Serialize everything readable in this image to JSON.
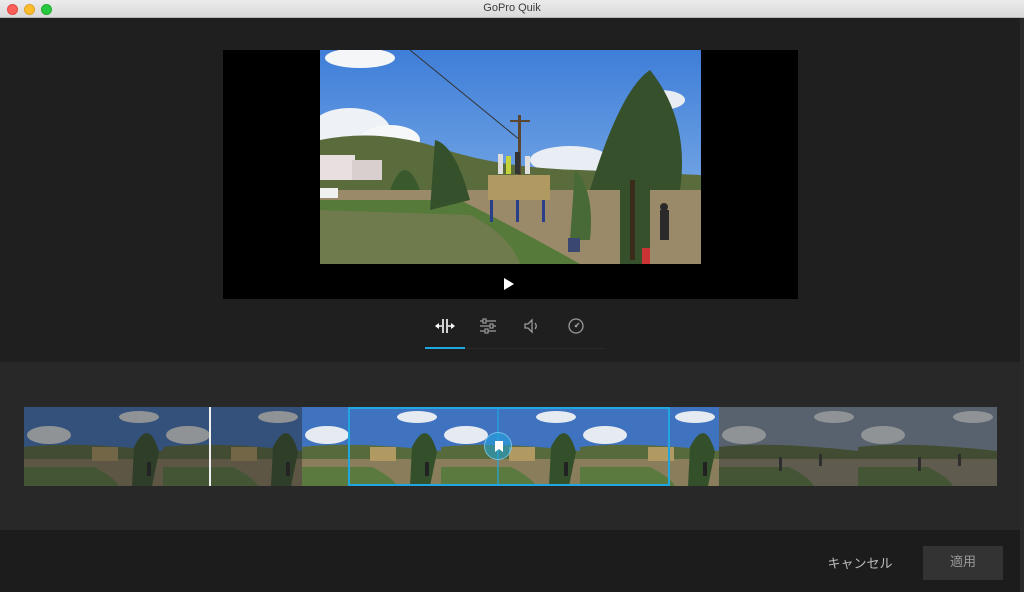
{
  "window": {
    "title": "GoPro Quik"
  },
  "player": {
    "play_icon": "play-icon"
  },
  "tools": [
    {
      "name": "trim",
      "icon": "trim-icon",
      "active": true
    },
    {
      "name": "adjust",
      "icon": "sliders-icon",
      "active": false
    },
    {
      "name": "audio",
      "icon": "speaker-icon",
      "active": false
    },
    {
      "name": "speed",
      "icon": "speedometer-icon",
      "active": false
    }
  ],
  "footer": {
    "cancel_label": "キャンセル",
    "apply_label": "適用"
  },
  "colors": {
    "accent": "#20a7e0",
    "background": "#1e1e1e",
    "timeline_bg": "#282828"
  }
}
